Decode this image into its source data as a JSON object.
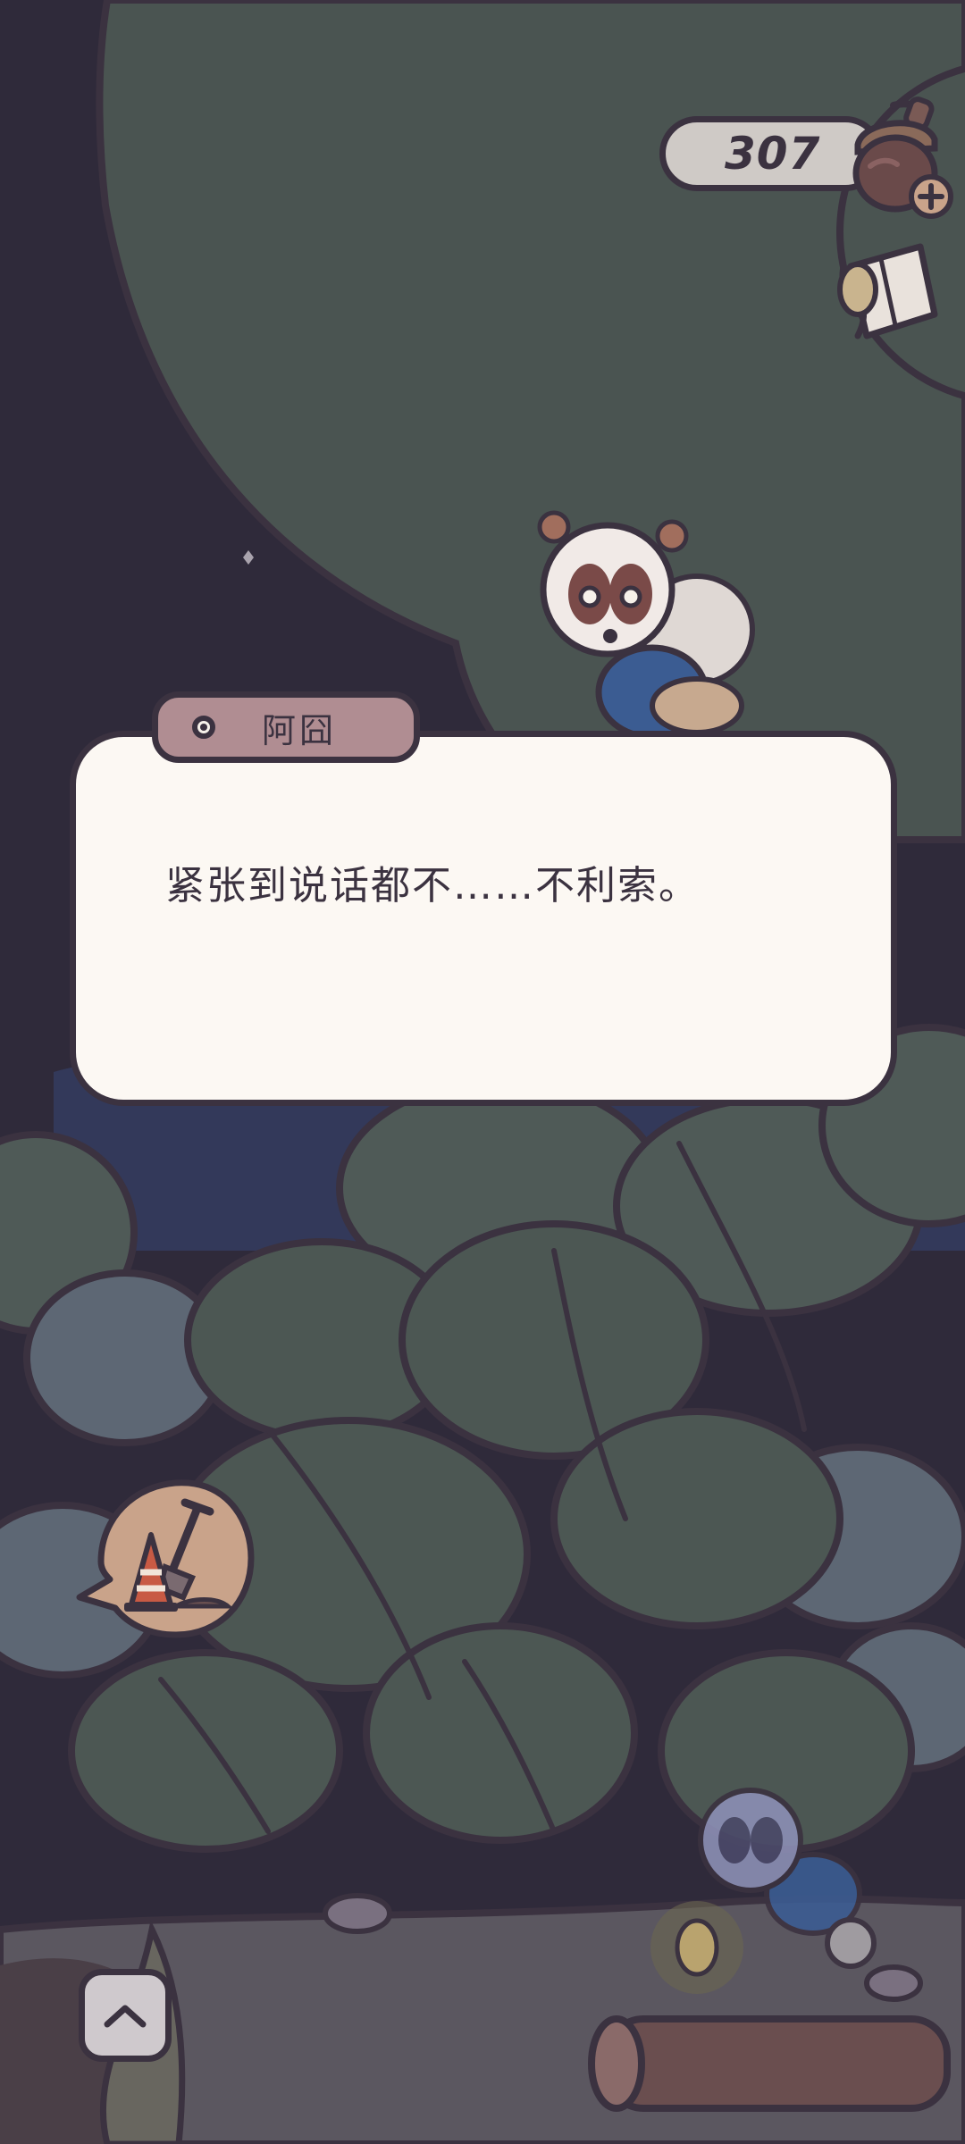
{
  "hud": {
    "currency_count": "307",
    "currency_icon": "acorn-icon",
    "map_icon": "map-icon"
  },
  "dialog": {
    "speaker": "阿囧",
    "text": "紧张到说话都不……不利索。"
  },
  "controls": {
    "tool_icon": "traffic-cone-shovel-icon",
    "expand_icon": "chevron-up-icon"
  },
  "colors": {
    "night_sky": "#2f2a3a",
    "tree_canopy": "#4a5451",
    "outline": "#3b3240",
    "dialog_bg": "#fcf8f3",
    "speaker_tab": "#b08d92",
    "pill_bg": "#cfcac6"
  }
}
